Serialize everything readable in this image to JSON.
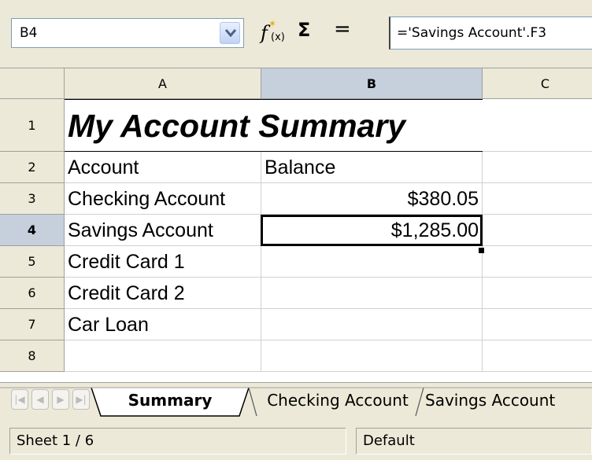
{
  "formula_bar": {
    "name_box": "B4",
    "function_wizard_icon": "function-wizard-icon",
    "sum_icon": "sum-icon",
    "sum_symbol": "Σ",
    "equal_symbol": "=",
    "formula": "='Savings Account'.F3"
  },
  "columns": [
    "A",
    "B",
    "C"
  ],
  "rows": [
    "1",
    "2",
    "3",
    "4",
    "5",
    "6",
    "7",
    "8"
  ],
  "cells": {
    "A1": "My Account Summary",
    "A2": "Account",
    "B2": "Balance",
    "A3": "Checking Account",
    "B3": "$380.05",
    "A4": "Savings Account",
    "B4": "$1,285.00",
    "A5": "Credit Card 1",
    "A6": "Credit Card 2",
    "A7": "Car Loan"
  },
  "selected_cell": "B4",
  "sheet_tabs": [
    "Summary",
    "Checking Account",
    "Savings Account"
  ],
  "active_tab": "Summary",
  "status_bar": {
    "sheet": "Sheet 1 / 6",
    "page_style": "Default"
  },
  "colors": {
    "chrome": "#ece9d8",
    "header_active": "#c5d0dc",
    "grid_line": "#d0d0d0"
  }
}
